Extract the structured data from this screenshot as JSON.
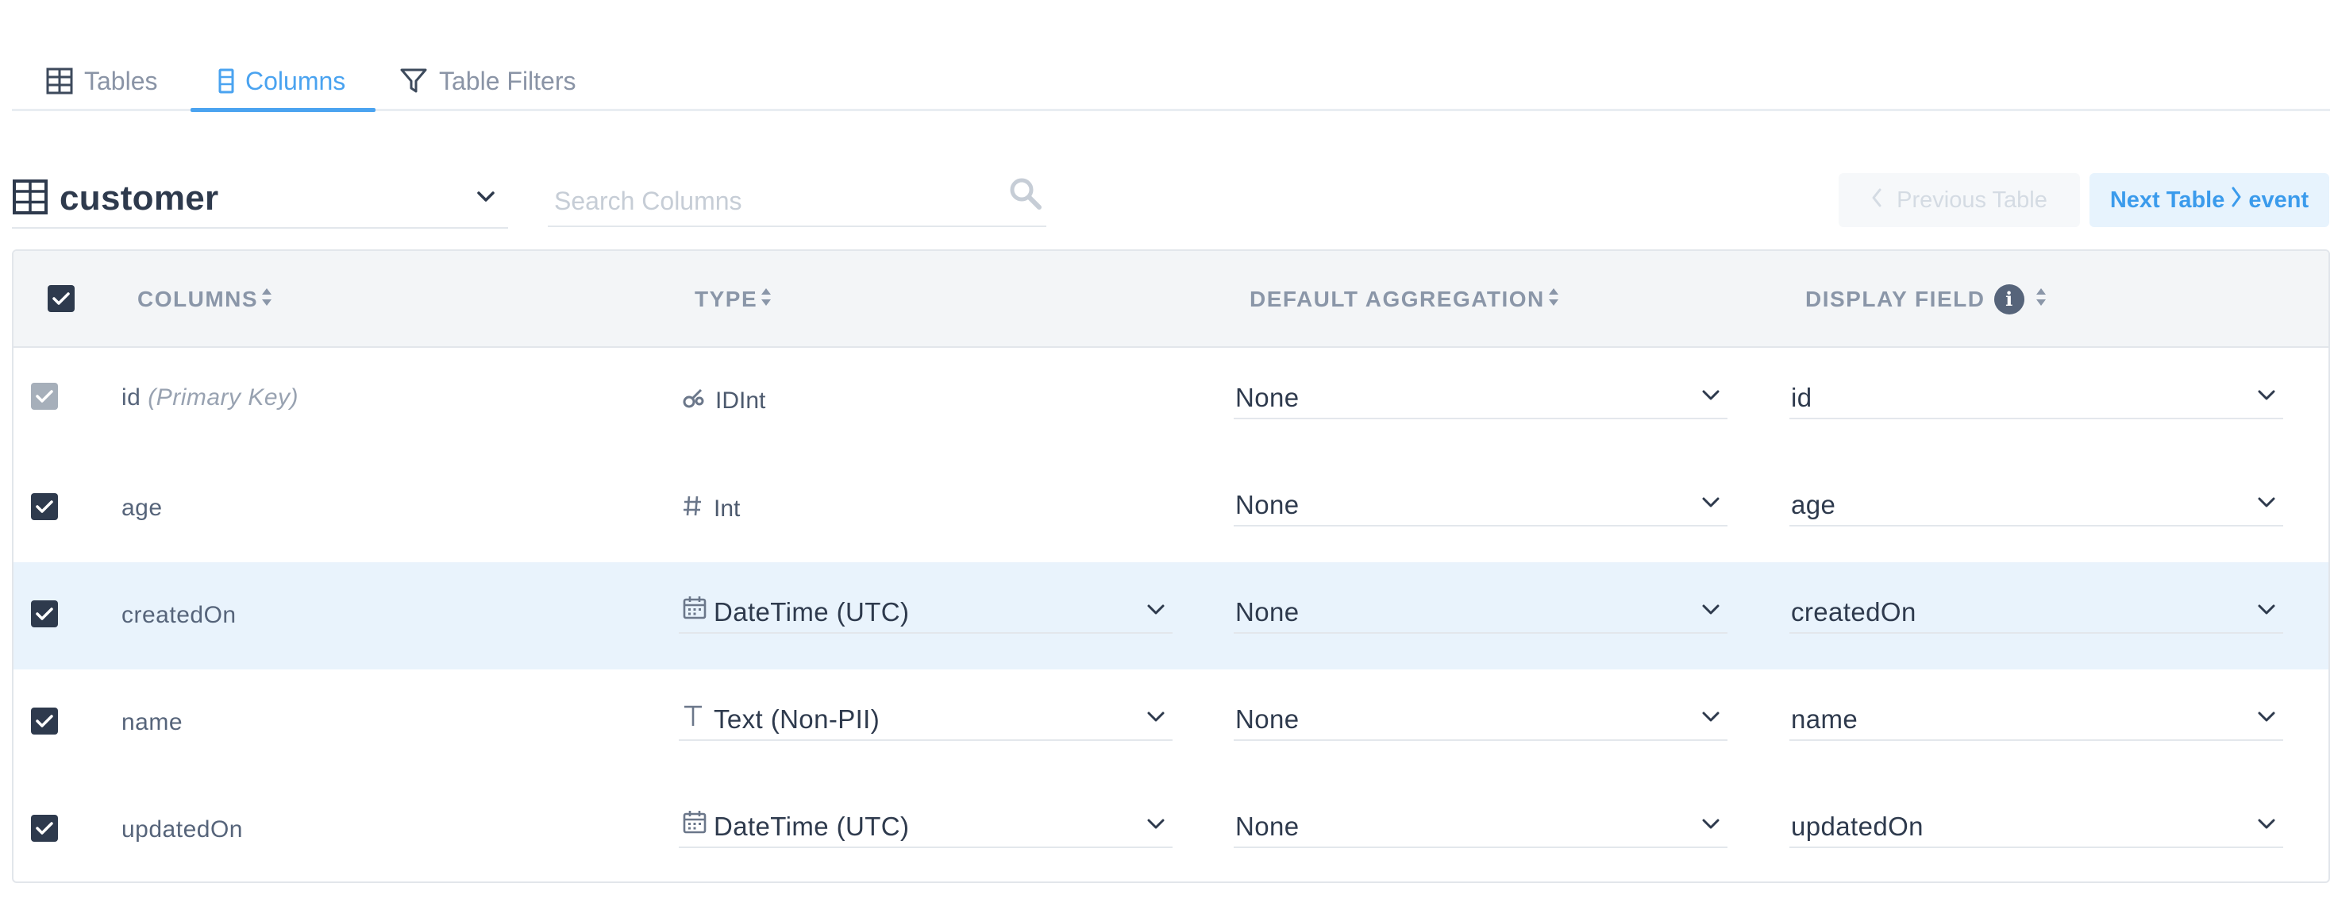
{
  "tabs": [
    {
      "label": "Tables",
      "icon": "table-icon",
      "active": false
    },
    {
      "label": "Columns",
      "icon": "columns-icon",
      "active": true
    },
    {
      "label": "Table Filters",
      "icon": "filter-icon",
      "active": false
    }
  ],
  "toolbar": {
    "table_name": "customer",
    "search_placeholder": "Search Columns",
    "search_value": "",
    "prev_label": "Previous Table",
    "next_label": "Next Table",
    "next_table": "event"
  },
  "header": {
    "columns": "COLUMNS",
    "type": "TYPE",
    "default_aggregation": "DEFAULT AGGREGATION",
    "display_field": "DISPLAY FIELD"
  },
  "rows": [
    {
      "name": "id",
      "note": "(Primary Key)",
      "checked": true,
      "disabled": true,
      "type": "IDInt",
      "type_icon": "key-icon",
      "type_editable": false,
      "aggregation": "None",
      "display_field": "id",
      "highlighted": false
    },
    {
      "name": "age",
      "note": "",
      "checked": true,
      "disabled": false,
      "type": "Int",
      "type_icon": "hash-icon",
      "type_editable": false,
      "aggregation": "None",
      "display_field": "age",
      "highlighted": false
    },
    {
      "name": "createdOn",
      "note": "",
      "checked": true,
      "disabled": false,
      "type": "DateTime (UTC)",
      "type_icon": "calendar-icon",
      "type_editable": true,
      "aggregation": "None",
      "display_field": "createdOn",
      "highlighted": true
    },
    {
      "name": "name",
      "note": "",
      "checked": true,
      "disabled": false,
      "type": "Text (Non-PII)",
      "type_icon": "text-icon",
      "type_editable": true,
      "aggregation": "None",
      "display_field": "name",
      "highlighted": false
    },
    {
      "name": "updatedOn",
      "note": "",
      "checked": true,
      "disabled": false,
      "type": "DateTime (UTC)",
      "type_icon": "calendar-icon",
      "type_editable": true,
      "aggregation": "None",
      "display_field": "updatedOn",
      "highlighted": false
    }
  ],
  "colors": {
    "accent": "#4aa3f0",
    "text_primary": "#2e3a4d",
    "text_muted": "#8a94a6",
    "row_highlight": "#e9f3fc",
    "checkbox": "#2e3a4d",
    "checkbox_disabled": "#a6afba"
  }
}
